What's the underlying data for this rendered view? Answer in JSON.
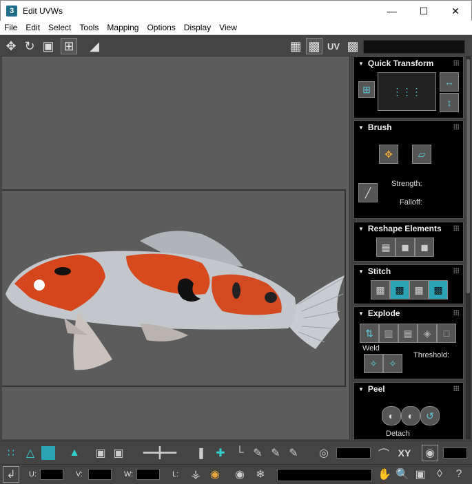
{
  "window": {
    "title": "Edit UVWs",
    "app_icon_label": "3"
  },
  "menu": [
    "File",
    "Edit",
    "Select",
    "Tools",
    "Mapping",
    "Options",
    "Display",
    "View"
  ],
  "toolbar": {
    "uv_label": "UV"
  },
  "rollouts": {
    "quick_transform": {
      "title": "Quick Transform"
    },
    "brush": {
      "title": "Brush",
      "strength_label": "Strength:",
      "falloff_label": "Falloff:"
    },
    "reshape": {
      "title": "Reshape Elements"
    },
    "stitch": {
      "title": "Stitch"
    },
    "explode": {
      "title": "Explode",
      "weld_label": "Weld",
      "threshold_label": "Threshold:"
    },
    "peel": {
      "title": "Peel",
      "detach_label": "Detach"
    }
  },
  "bottom": {
    "xy_label": "XY",
    "u_label": "U:",
    "v_label": "V:",
    "w_label": "W:",
    "l_label": "L:"
  },
  "colors": {
    "accent": "#2aa3b4",
    "viewport": "#5c5c5c",
    "panel_bg": "#000000",
    "fish_orange": "#d6461d"
  }
}
